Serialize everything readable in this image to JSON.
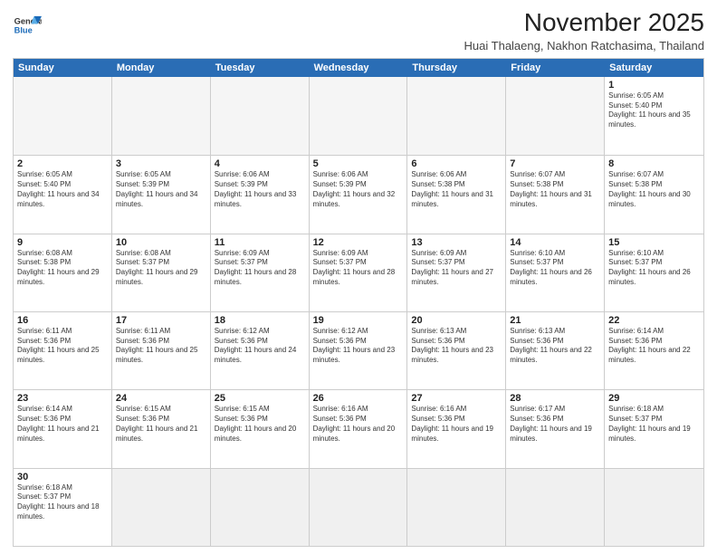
{
  "header": {
    "logo_line1": "General",
    "logo_line2": "Blue",
    "month_title": "November 2025",
    "subtitle": "Huai Thalaeng, Nakhon Ratchasima, Thailand"
  },
  "day_headers": [
    "Sunday",
    "Monday",
    "Tuesday",
    "Wednesday",
    "Thursday",
    "Friday",
    "Saturday"
  ],
  "weeks": [
    {
      "days": [
        {
          "num": "",
          "empty": true
        },
        {
          "num": "",
          "empty": true
        },
        {
          "num": "",
          "empty": true
        },
        {
          "num": "",
          "empty": true
        },
        {
          "num": "",
          "empty": true
        },
        {
          "num": "",
          "empty": true
        },
        {
          "num": "1",
          "sunrise": "Sunrise: 6:05 AM",
          "sunset": "Sunset: 5:40 PM",
          "daylight": "Daylight: 11 hours and 35 minutes."
        }
      ]
    },
    {
      "days": [
        {
          "num": "2",
          "sunrise": "Sunrise: 6:05 AM",
          "sunset": "Sunset: 5:40 PM",
          "daylight": "Daylight: 11 hours and 34 minutes."
        },
        {
          "num": "3",
          "sunrise": "Sunrise: 6:05 AM",
          "sunset": "Sunset: 5:39 PM",
          "daylight": "Daylight: 11 hours and 34 minutes."
        },
        {
          "num": "4",
          "sunrise": "Sunrise: 6:06 AM",
          "sunset": "Sunset: 5:39 PM",
          "daylight": "Daylight: 11 hours and 33 minutes."
        },
        {
          "num": "5",
          "sunrise": "Sunrise: 6:06 AM",
          "sunset": "Sunset: 5:39 PM",
          "daylight": "Daylight: 11 hours and 32 minutes."
        },
        {
          "num": "6",
          "sunrise": "Sunrise: 6:06 AM",
          "sunset": "Sunset: 5:38 PM",
          "daylight": "Daylight: 11 hours and 31 minutes."
        },
        {
          "num": "7",
          "sunrise": "Sunrise: 6:07 AM",
          "sunset": "Sunset: 5:38 PM",
          "daylight": "Daylight: 11 hours and 31 minutes."
        },
        {
          "num": "8",
          "sunrise": "Sunrise: 6:07 AM",
          "sunset": "Sunset: 5:38 PM",
          "daylight": "Daylight: 11 hours and 30 minutes."
        }
      ]
    },
    {
      "days": [
        {
          "num": "9",
          "sunrise": "Sunrise: 6:08 AM",
          "sunset": "Sunset: 5:38 PM",
          "daylight": "Daylight: 11 hours and 29 minutes."
        },
        {
          "num": "10",
          "sunrise": "Sunrise: 6:08 AM",
          "sunset": "Sunset: 5:37 PM",
          "daylight": "Daylight: 11 hours and 29 minutes."
        },
        {
          "num": "11",
          "sunrise": "Sunrise: 6:09 AM",
          "sunset": "Sunset: 5:37 PM",
          "daylight": "Daylight: 11 hours and 28 minutes."
        },
        {
          "num": "12",
          "sunrise": "Sunrise: 6:09 AM",
          "sunset": "Sunset: 5:37 PM",
          "daylight": "Daylight: 11 hours and 28 minutes."
        },
        {
          "num": "13",
          "sunrise": "Sunrise: 6:09 AM",
          "sunset": "Sunset: 5:37 PM",
          "daylight": "Daylight: 11 hours and 27 minutes."
        },
        {
          "num": "14",
          "sunrise": "Sunrise: 6:10 AM",
          "sunset": "Sunset: 5:37 PM",
          "daylight": "Daylight: 11 hours and 26 minutes."
        },
        {
          "num": "15",
          "sunrise": "Sunrise: 6:10 AM",
          "sunset": "Sunset: 5:37 PM",
          "daylight": "Daylight: 11 hours and 26 minutes."
        }
      ]
    },
    {
      "days": [
        {
          "num": "16",
          "sunrise": "Sunrise: 6:11 AM",
          "sunset": "Sunset: 5:36 PM",
          "daylight": "Daylight: 11 hours and 25 minutes."
        },
        {
          "num": "17",
          "sunrise": "Sunrise: 6:11 AM",
          "sunset": "Sunset: 5:36 PM",
          "daylight": "Daylight: 11 hours and 25 minutes."
        },
        {
          "num": "18",
          "sunrise": "Sunrise: 6:12 AM",
          "sunset": "Sunset: 5:36 PM",
          "daylight": "Daylight: 11 hours and 24 minutes."
        },
        {
          "num": "19",
          "sunrise": "Sunrise: 6:12 AM",
          "sunset": "Sunset: 5:36 PM",
          "daylight": "Daylight: 11 hours and 23 minutes."
        },
        {
          "num": "20",
          "sunrise": "Sunrise: 6:13 AM",
          "sunset": "Sunset: 5:36 PM",
          "daylight": "Daylight: 11 hours and 23 minutes."
        },
        {
          "num": "21",
          "sunrise": "Sunrise: 6:13 AM",
          "sunset": "Sunset: 5:36 PM",
          "daylight": "Daylight: 11 hours and 22 minutes."
        },
        {
          "num": "22",
          "sunrise": "Sunrise: 6:14 AM",
          "sunset": "Sunset: 5:36 PM",
          "daylight": "Daylight: 11 hours and 22 minutes."
        }
      ]
    },
    {
      "days": [
        {
          "num": "23",
          "sunrise": "Sunrise: 6:14 AM",
          "sunset": "Sunset: 5:36 PM",
          "daylight": "Daylight: 11 hours and 21 minutes."
        },
        {
          "num": "24",
          "sunrise": "Sunrise: 6:15 AM",
          "sunset": "Sunset: 5:36 PM",
          "daylight": "Daylight: 11 hours and 21 minutes."
        },
        {
          "num": "25",
          "sunrise": "Sunrise: 6:15 AM",
          "sunset": "Sunset: 5:36 PM",
          "daylight": "Daylight: 11 hours and 20 minutes."
        },
        {
          "num": "26",
          "sunrise": "Sunrise: 6:16 AM",
          "sunset": "Sunset: 5:36 PM",
          "daylight": "Daylight: 11 hours and 20 minutes."
        },
        {
          "num": "27",
          "sunrise": "Sunrise: 6:16 AM",
          "sunset": "Sunset: 5:36 PM",
          "daylight": "Daylight: 11 hours and 19 minutes."
        },
        {
          "num": "28",
          "sunrise": "Sunrise: 6:17 AM",
          "sunset": "Sunset: 5:36 PM",
          "daylight": "Daylight: 11 hours and 19 minutes."
        },
        {
          "num": "29",
          "sunrise": "Sunrise: 6:18 AM",
          "sunset": "Sunset: 5:37 PM",
          "daylight": "Daylight: 11 hours and 19 minutes."
        }
      ]
    },
    {
      "days": [
        {
          "num": "30",
          "sunrise": "Sunrise: 6:18 AM",
          "sunset": "Sunset: 5:37 PM",
          "daylight": "Daylight: 11 hours and 18 minutes."
        },
        {
          "num": "",
          "empty": true
        },
        {
          "num": "",
          "empty": true
        },
        {
          "num": "",
          "empty": true
        },
        {
          "num": "",
          "empty": true
        },
        {
          "num": "",
          "empty": true
        },
        {
          "num": "",
          "empty": true
        }
      ]
    }
  ]
}
